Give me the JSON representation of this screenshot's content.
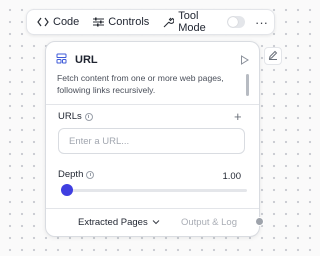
{
  "toolbar": {
    "code_label": "Code",
    "controls_label": "Controls",
    "tool_mode_label": "Tool Mode",
    "tool_mode_enabled": false,
    "more_label": "···"
  },
  "node": {
    "title": "URL",
    "description": "Fetch content from one or more web pages, following links recursively.",
    "urls": {
      "label": "URLs",
      "add_label": "+",
      "placeholder": "Enter a URL..."
    },
    "depth": {
      "label": "Depth",
      "value": "1.00"
    },
    "tabs": {
      "extracted_pages": "Extracted Pages",
      "output_log": "Output & Log"
    }
  },
  "colors": {
    "accent": "#3f3ee0",
    "muted_text": "#a9adb5"
  }
}
